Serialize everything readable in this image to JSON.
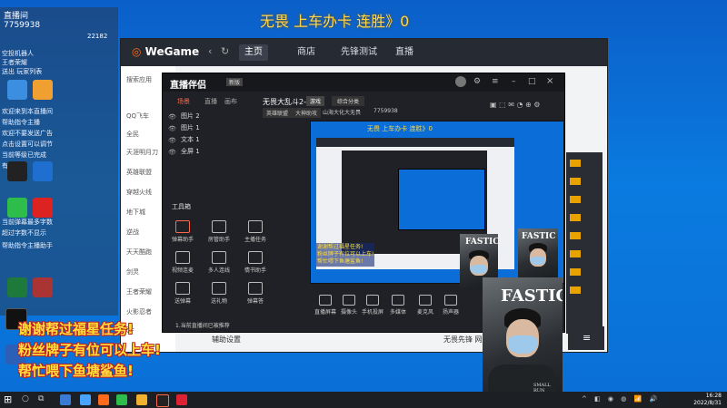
{
  "stream_title": "无畏 上车办卡 连胜》0",
  "chat": {
    "room": "直播间",
    "id": "7759938",
    "count": "22182",
    "lines": [
      "空投机器人",
      "王者荣耀",
      "送出 玩家列表",
      "欢迎来到本直播间",
      "帮助指令主播",
      "欢迎不要发送广告",
      "点击设置可以调节",
      "当前等级已完成",
      "有效任务",
      "当前弹幕最多字数",
      "超过字数不显示",
      "帮助指令主播助手"
    ]
  },
  "subtitles": [
    "谢谢帮过福星任务!",
    "粉丝牌子有位可以上车!",
    "帮忙喂下鱼塘鲨鱼!"
  ],
  "wegame": {
    "logo": "WeGame",
    "nav": [
      "主页",
      "商店",
      "先锋测试",
      "直播"
    ],
    "sidebar": [
      "搜索应用",
      "QQ飞车",
      "全民",
      "天涯明月刀",
      "英雄联盟",
      "穿越火线",
      "地下城",
      "逆战",
      "天天酷跑",
      "剑灵",
      "王者荣耀",
      "火影忍者",
      "CF"
    ],
    "status_left": "辅助设置",
    "status_right": "无畏先锋 网通"
  },
  "zbbl": {
    "brand": "直播伴侣",
    "version": "新版",
    "tabs": [
      "场景",
      "直播",
      "画布"
    ],
    "scenes": [
      "图片 2",
      "图片 1",
      "文本 1",
      "全屏 1"
    ],
    "toolbox_label": "工具箱",
    "tools": [
      "弹幕助手",
      "房管助手",
      "主播任务",
      "视频连麦",
      "多人连线",
      "情书助手",
      "送弹幕",
      "送礼物",
      "弹幕答"
    ],
    "room_name": "无畏大乱斗2-4",
    "room_tag": "游戏",
    "room_tag2": "综合分类",
    "room_meta": [
      "英雄联盟",
      "大神助攻",
      "山海大化大无畏",
      "7759938"
    ],
    "preview_title": "无畏 上车办卡 连胜》0",
    "preview_chat": [
      "谢谢帮过福星任务!",
      "粉丝牌子有位可以上车!",
      "帮忙喂下鱼塘鲨鱼!"
    ],
    "controls": [
      "直播屏幕",
      "摄像头",
      "手机投屏",
      "多媒体",
      "麦克风",
      "扬声器"
    ],
    "hint": "1.当前直播间已被推荐"
  },
  "webcam": {
    "logo_text": "FASTIC",
    "hoodie_text": "SMALL RUN"
  },
  "taskbar": {
    "time": "16:28",
    "date": "2022/8/31"
  },
  "colors": {
    "desktop": "#0a7be0",
    "accent": "#ff6a1a",
    "banner": "#ffd84a",
    "subtitle": "#ffe03a",
    "subtitle_outline": "#c02020"
  }
}
